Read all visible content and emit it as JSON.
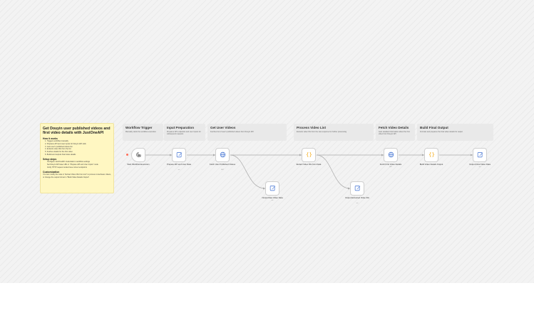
{
  "sticky": {
    "title": "Get Douyin user published videos and first video details with JustOneAPI",
    "how_title": "How it works",
    "how_items": [
      "1. Triggers workflow manually",
      "2. Prepares API and user inputs for Douyin API calls",
      "3. Gets user's published videos list",
      "4. Extracts video IDs from the list",
      "5. Fetches details for the first video",
      "6. Builds and outputs final video details"
    ],
    "setup_title": "Setup steps",
    "setup_items": [
      "Configure JustOneAPI credentials in workflow settings",
      "Set Douyin API base URL in \"Prepare API and User Inputs\" node",
      "Verify HTTP request nodes have correct endpoints"
    ],
    "custom_title": "Customization",
    "custom_text": "You can modify the code in \"Extract Video IDs from List\" to process more/fewer videos, or change the output format in \"Build Video Details Output\"."
  },
  "sections": [
    {
      "title": "Workflow Trigger",
      "desc": "Manually starts the workflow execution"
    },
    {
      "title": "Input Preparation",
      "desc": "Prepares API endpoints and user inputs for subsequent requests"
    },
    {
      "title": "Get User Videos",
      "desc": "Fetches list of user's published videos from Douyin API"
    },
    {
      "title": "Process Video List",
      "desc": "Extracts video IDs from the raw response for further processing"
    },
    {
      "title": "Fetch Video Details",
      "desc": "Gets detailed information about the first video from Douyin API"
    },
    {
      "title": "Build Final Output",
      "desc": "Formats and prepares the final video details for output"
    }
  ],
  "nodes": [
    {
      "label": "Start Workflow Execution",
      "icon": "pointer-click-icon",
      "sub": ""
    },
    {
      "label": "Prepare API and User Data",
      "icon": "edit-icon",
      "sub": "set"
    },
    {
      "label": "Fetch User Published Videos",
      "icon": "globe-icon",
      "sub": "GET"
    },
    {
      "label": "Output Raw Video Data",
      "icon": "edit-icon",
      "sub": "set"
    },
    {
      "label": "Extract Video IDs from Data",
      "icon": "code-icon",
      "sub": ""
    },
    {
      "label": "Output Extracted Video IDs",
      "icon": "edit-icon",
      "sub": "set"
    },
    {
      "label": "Fetch First Video Details",
      "icon": "globe-icon",
      "sub": "GET"
    },
    {
      "label": "Build Video Details Output",
      "icon": "code-icon",
      "sub": ""
    },
    {
      "label": "Output Final Video Data",
      "icon": "edit-icon",
      "sub": "set"
    }
  ],
  "colors": {
    "edge": "#a8a8a8",
    "trigger_accent": "#ff6d5a",
    "code_icon": "#f4a300",
    "set_icon": "#3d6fd1",
    "http_icon": "#3d6fd1",
    "sticky_bg": "#fff7c2"
  }
}
